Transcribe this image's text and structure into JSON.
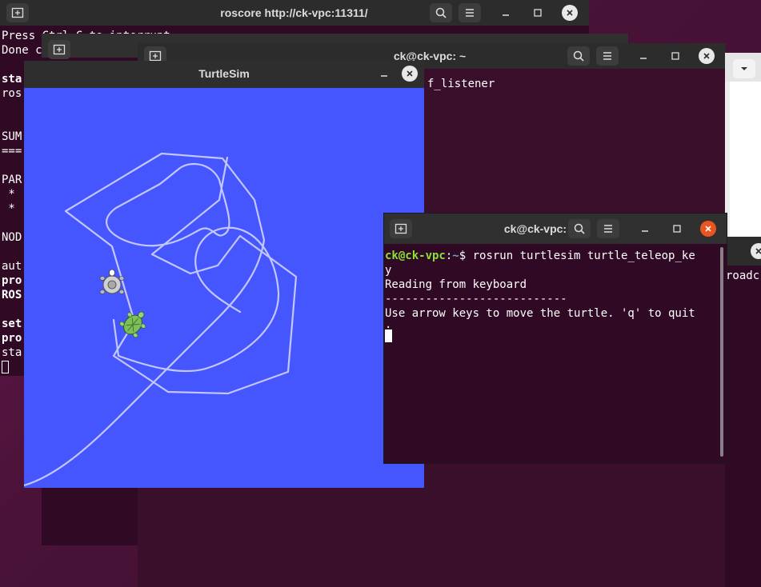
{
  "windows": {
    "roscore": {
      "title": "roscore http://ck-vpc:11311/",
      "lines": [
        "Press Ctrl-C to interrupt",
        "Done c",
        "",
        "sta",
        "ros",
        "",
        "",
        "SUM",
        "===",
        "",
        "PAR",
        " *",
        " *",
        "",
        "NOD",
        "",
        "aut",
        "pro",
        "ROS",
        "",
        "set",
        "pro",
        "sta"
      ],
      "bold_lines": [
        3,
        17,
        18,
        20,
        21
      ]
    },
    "back_term": {
      "title": "ck@ck-vpc: ~",
      "visible_text": "f_listener"
    },
    "right_term": {
      "visible_text": "roadc"
    },
    "turtlesim": {
      "title": "TurtleSim",
      "canvas_color": "#4556ff",
      "path_color": "#c2c7ff"
    },
    "teleop": {
      "title": "ck@ck-vpc: ~",
      "prompt_user": "ck@ck-vpc",
      "prompt_sep": ":",
      "prompt_path": "~",
      "prompt_dollar": "$ ",
      "command_line1": "rosrun turtlesim turtle_teleop_ke",
      "command_line2": "y",
      "output": [
        "Reading from keyboard",
        "---------------------------",
        "Use arrow keys to move the turtle. 'q' to quit",
        "."
      ]
    }
  },
  "colors": {
    "terminal_bg": "#300a24",
    "titlebar": "#2c2c2c",
    "ubuntu_orange": "#e95420",
    "prompt_green": "#8ae234",
    "prompt_blue": "#729fcf"
  },
  "icons": {
    "new_tab": "new-tab-icon",
    "search": "search-icon",
    "menu": "hamburger-menu-icon",
    "minimize": "minimize-icon",
    "maximize": "maximize-icon",
    "close": "close-icon"
  }
}
